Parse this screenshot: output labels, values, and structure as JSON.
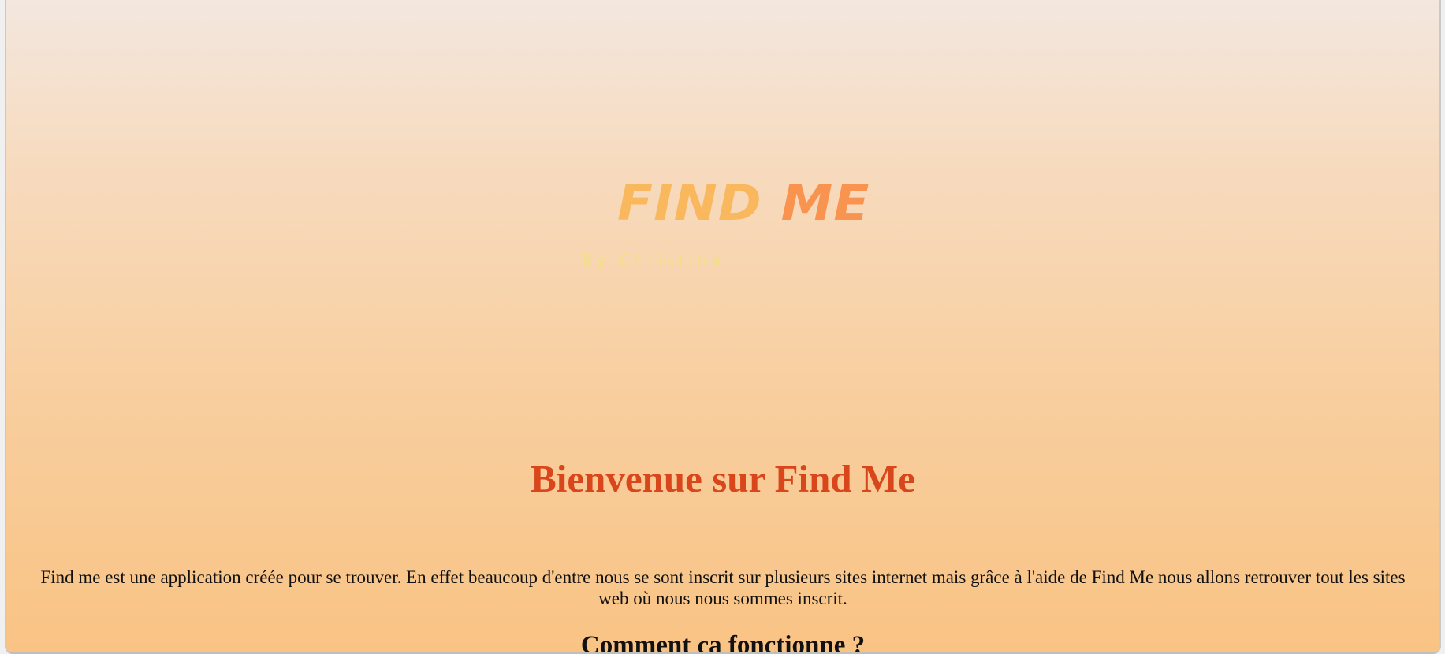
{
  "logo": {
    "word1": "FIND",
    "word2": "ME",
    "byline": "By Christina",
    "colors": {
      "word1": "#f9b85e",
      "word2": "#f99350",
      "byline": "#f2e27e"
    }
  },
  "main": {
    "heading": "Bienvenue sur Find Me",
    "intro": "Find me est une application créée pour se trouver. En effet beaucoup d'entre nous se sont inscrit sur plusieurs sites internet mais grâce à l'aide de Find Me nous allons retrouver tout les sites web où nous nous sommes inscrit.",
    "subheading": "Comment ça fonctionne ?"
  },
  "colors": {
    "heading": "#d9461b",
    "text": "#111111",
    "background_top": "#f3e7df",
    "background_bottom": "#f9c384"
  }
}
